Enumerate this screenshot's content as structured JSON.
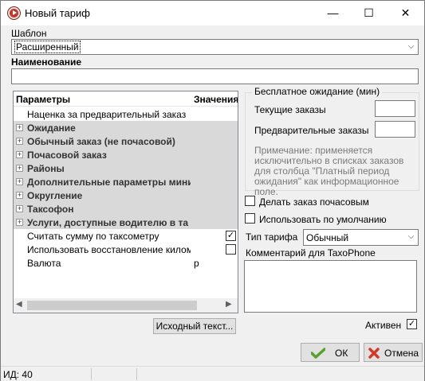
{
  "window": {
    "title": "Новый тариф",
    "minimize": "—",
    "maximize": "☐",
    "close": "✕"
  },
  "template": {
    "label": "Шаблон",
    "value": "Расширенный"
  },
  "name": {
    "label": "Наименование",
    "value": ""
  },
  "params": {
    "col_params": "Параметры",
    "col_values": "Значения",
    "rows": [
      {
        "label": "Наценка за предварительный заказ",
        "kind": "plain",
        "value": ""
      },
      {
        "label": "Ожидание",
        "kind": "group"
      },
      {
        "label": "Обычный заказ (не почасовой)",
        "kind": "group"
      },
      {
        "label": "Почасовой заказ",
        "kind": "group"
      },
      {
        "label": "Районы",
        "kind": "group"
      },
      {
        "label": "Дополнительные параметры мини",
        "kind": "group"
      },
      {
        "label": "Округление",
        "kind": "group"
      },
      {
        "label": "Таксофон",
        "kind": "group"
      },
      {
        "label": "Услуги, доступные водителю в та",
        "kind": "group"
      },
      {
        "label": "Считать сумму по таксометру",
        "kind": "check",
        "checked": true
      },
      {
        "label": "Использовать восстановление километ",
        "kind": "check",
        "checked": false
      },
      {
        "label": "Валюта",
        "kind": "plain",
        "value": "р"
      }
    ],
    "expand_glyph": "+",
    "check_glyph": "✓"
  },
  "free_wait": {
    "title": "Бесплатное ожидание (мин)",
    "current_label": "Текущие заказы",
    "current_value": "",
    "prelim_label": "Предварительные заказы",
    "prelim_value": "",
    "note": "Примечание: применяется исключительно в списках заказов для столбца \"Платный период ожидания\" как информационное поле."
  },
  "options": {
    "hourly_label": "Делать заказ почасовым",
    "hourly_checked": false,
    "default_label": "Использовать по умолчанию",
    "default_checked": false
  },
  "tariff_type": {
    "label": "Тип тарифа",
    "value": "Обычный"
  },
  "comment": {
    "label": "Комментарий для TaxoPhone",
    "value": ""
  },
  "active": {
    "label": "Активен",
    "checked": true
  },
  "source_button": "Исходный текст...",
  "ok_button": "ОК",
  "cancel_button": "Отмена",
  "status": {
    "id_text": "ИД: 40"
  },
  "colors": {
    "group_bg": "#d9d9d9",
    "ok_green": "#5aa02c",
    "cancel_red": "#d23a2a",
    "accent": "#c0392b"
  }
}
